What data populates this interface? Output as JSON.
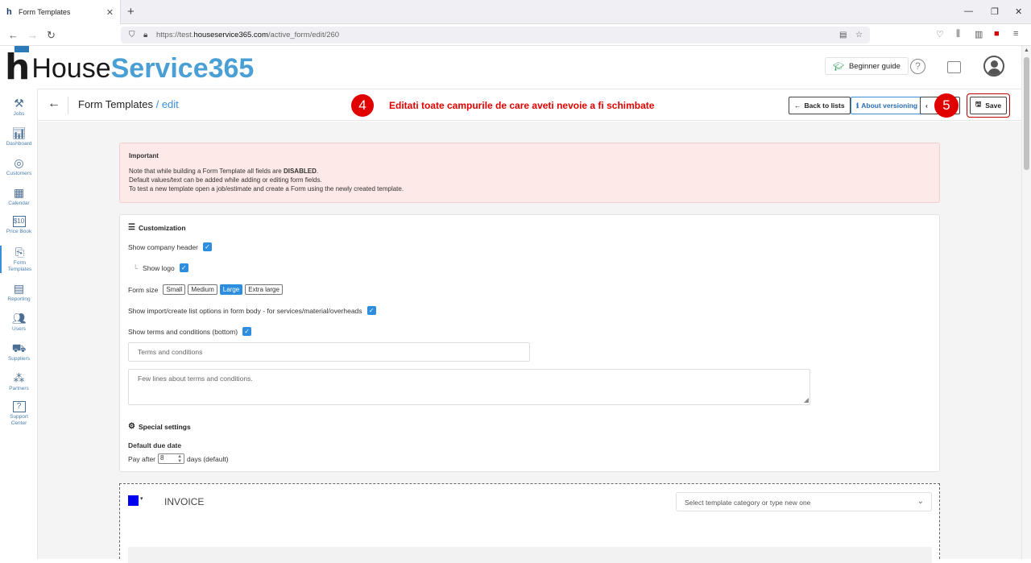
{
  "browser": {
    "tab_title": "Form Templates",
    "new_tab": "+",
    "url_prefix": "https://test.",
    "url_domain": "houseservice365.com",
    "url_path": "/active_form/edit/260"
  },
  "app": {
    "logo_house": "House",
    "logo_service": "Service365",
    "beginner_guide": "Beginner guide"
  },
  "sidebar": {
    "items": [
      {
        "label": "Jobs",
        "icon": "tools-icon"
      },
      {
        "label": "Dashboard",
        "icon": "chart-icon"
      },
      {
        "label": "Customers",
        "icon": "customers-icon"
      },
      {
        "label": "Calendar",
        "icon": "calendar-icon"
      },
      {
        "label": "Price Book",
        "icon": "price-icon"
      },
      {
        "label": "Form",
        "label2": "Templates",
        "icon": "form-icon"
      },
      {
        "label": "Reporting",
        "icon": "report-icon"
      },
      {
        "label": "Users",
        "icon": "users-icon"
      },
      {
        "label": "Suppliers",
        "icon": "truck-icon"
      },
      {
        "label": "Partners",
        "icon": "partners-icon"
      },
      {
        "label": "Support",
        "label2": "Center",
        "icon": "support-icon"
      }
    ]
  },
  "subheader": {
    "title": "Form Templates",
    "edit": "/ edit",
    "step4": "4",
    "annotation": "Editati toate campurile de care aveti nevoie a fi schimbate",
    "back_to_lists": "Back to lists",
    "about_versioning": "About versioning",
    "step5": "5",
    "save": "Save"
  },
  "important": {
    "title": "Important",
    "line1_pre": "Note that while building a Form Template all fields are ",
    "line1_bold": "DISABLED",
    "line1_post": ".",
    "line2": "Default values/text can be added while adding or editing form fields.",
    "line3": "To test a new template open a job/estimate and create a Form using the newly created template."
  },
  "customization": {
    "title": "Customization",
    "show_company_header": "Show company header",
    "show_logo": "Show logo",
    "form_size_label": "Form size",
    "sizes": [
      "Small",
      "Medium",
      "Large",
      "Extra large"
    ],
    "selected_size": "Large",
    "show_import": "Show import/create list options in form body - for services/material/overheads",
    "show_terms": "Show terms and conditions (bottom)",
    "terms_placeholder": "Terms and conditions",
    "terms_text_placeholder": "Few lines about terms and conditions."
  },
  "special": {
    "title": "Special settings",
    "default_due": "Default due date",
    "pay_after": "Pay after",
    "days_value": "8",
    "days_label": "days (default)"
  },
  "invoice": {
    "title": "INVOICE",
    "swatch_color": "#0000ee",
    "category_placeholder": "Select template category or type new one"
  }
}
